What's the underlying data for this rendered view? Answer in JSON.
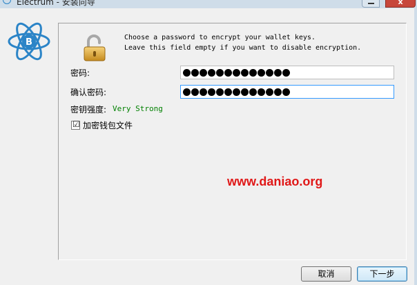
{
  "window": {
    "title": "Electrum  -  安装向导",
    "close_glyph": "x"
  },
  "header": {
    "message_line1": "Choose a password to encrypt your wallet keys.",
    "message_line2": "Leave this field empty if you want to disable encryption."
  },
  "form": {
    "password_label": "密码:",
    "confirm_label": "确认密码:",
    "password_masked_count": 13,
    "confirm_masked_count": 13,
    "strength_label": "密钥强度:",
    "strength_value": "Very Strong",
    "encrypt_file_label": "加密钱包文件",
    "encrypt_file_checked": true
  },
  "watermark": "www.daniao.org",
  "buttons": {
    "cancel": "取消",
    "next": "下一步"
  },
  "icons": {
    "app_logo": "electrum-bitcoin-logo",
    "lock": "open-padlock-icon",
    "checkmark": "☑"
  },
  "colors": {
    "strength": "#008000",
    "watermark": "#e01818",
    "logo_blue": "#2b84c7"
  }
}
